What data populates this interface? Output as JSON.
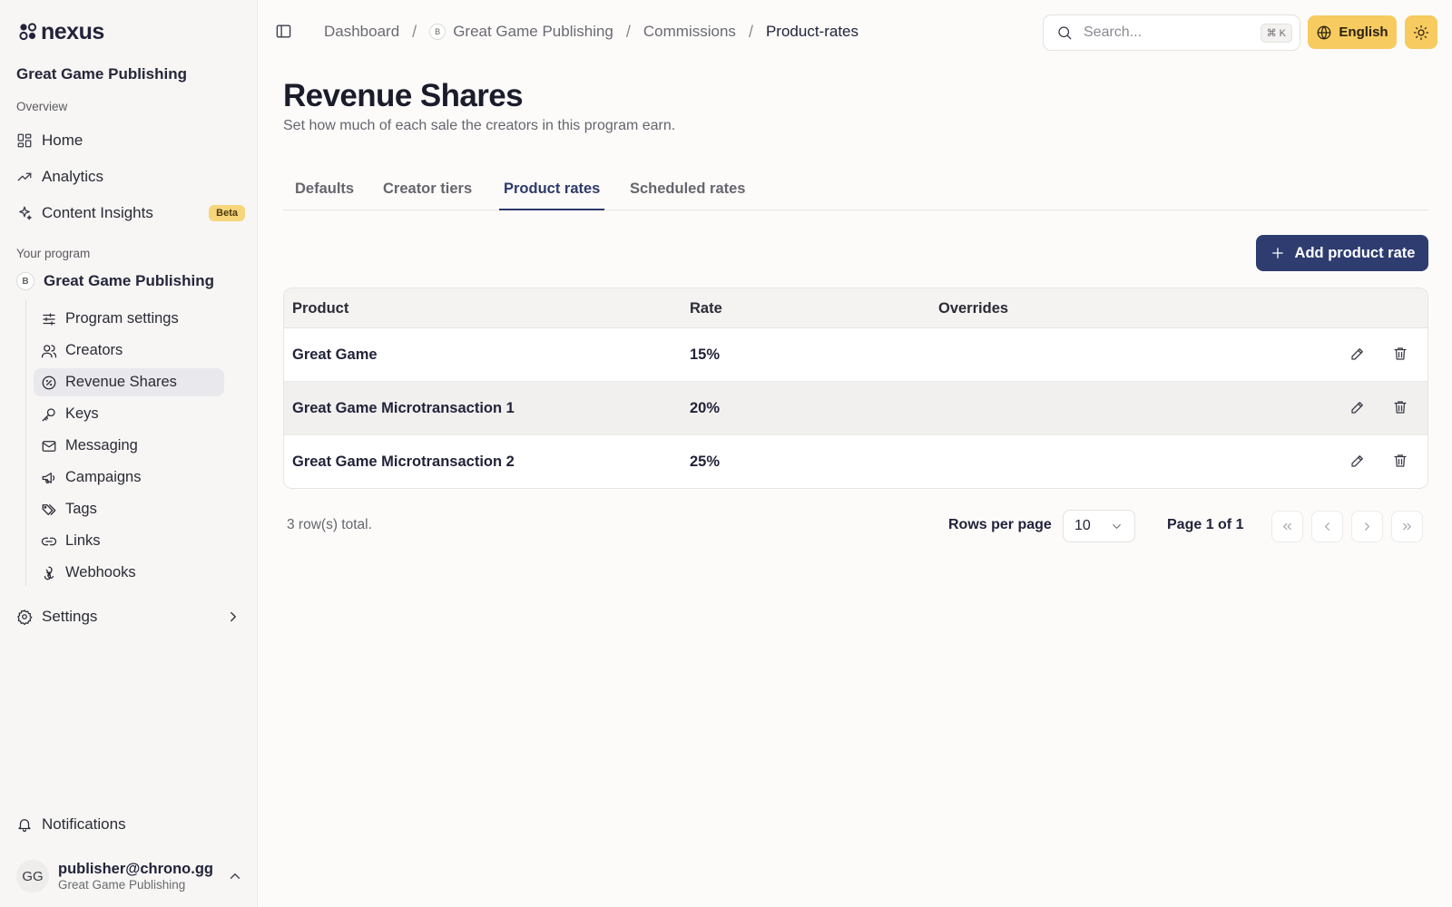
{
  "brand": {
    "name": "nexus"
  },
  "sidebar": {
    "org_name": "Great Game Publishing",
    "overview_label": "Overview",
    "overview_items": [
      {
        "label": "Home",
        "icon": "grid-icon"
      },
      {
        "label": "Analytics",
        "icon": "trending-up-icon"
      },
      {
        "label": "Content Insights",
        "icon": "sparkle-icon",
        "badge": "Beta"
      }
    ],
    "program_label": "Your program",
    "program": {
      "initial": "B",
      "name": "Great Game Publishing"
    },
    "program_items": [
      {
        "label": "Program settings",
        "icon": "sliders-icon"
      },
      {
        "label": "Creators",
        "icon": "users-icon"
      },
      {
        "label": "Revenue Shares",
        "icon": "percent-badge-icon",
        "active": true
      },
      {
        "label": "Keys",
        "icon": "key-icon"
      },
      {
        "label": "Messaging",
        "icon": "mail-icon"
      },
      {
        "label": "Campaigns",
        "icon": "megaphone-icon"
      },
      {
        "label": "Tags",
        "icon": "tags-icon"
      },
      {
        "label": "Links",
        "icon": "link-icon"
      },
      {
        "label": "Webhooks",
        "icon": "webhook-icon"
      }
    ],
    "settings_label": "Settings",
    "notifications_label": "Notifications",
    "user": {
      "initials": "GG",
      "email": "publisher@chrono.gg",
      "org": "Great Game Publishing"
    }
  },
  "header": {
    "breadcrumb": [
      {
        "label": "Dashboard"
      },
      {
        "label": "Great Game Publishing",
        "initial": "B"
      },
      {
        "label": "Commissions"
      },
      {
        "label": "Product-rates"
      }
    ],
    "search_placeholder": "Search...",
    "search_shortcut": "⌘ K",
    "language": "English"
  },
  "main": {
    "title": "Revenue Shares",
    "subtitle": "Set how much of each sale the creators in this program earn.",
    "tabs": [
      {
        "label": "Defaults"
      },
      {
        "label": "Creator tiers"
      },
      {
        "label": "Product rates",
        "active": true
      },
      {
        "label": "Scheduled rates"
      }
    ],
    "add_button_label": "Add product rate",
    "table": {
      "columns": [
        "Product",
        "Rate",
        "Overrides"
      ],
      "rows": [
        {
          "product": "Great Game",
          "rate": "15%",
          "overrides": ""
        },
        {
          "product": "Great Game Microtransaction 1",
          "rate": "20%",
          "overrides": ""
        },
        {
          "product": "Great Game Microtransaction 2",
          "rate": "25%",
          "overrides": ""
        }
      ]
    },
    "pagination": {
      "rows_total": "3 row(s) total.",
      "rows_per_page_label": "Rows per page",
      "rows_per_page_value": "10",
      "page_label": "Page 1 of 1"
    }
  },
  "colors": {
    "accent": "#2e3c6f",
    "highlight": "#f7cb5f",
    "beta_badge": "#f7d57b"
  }
}
